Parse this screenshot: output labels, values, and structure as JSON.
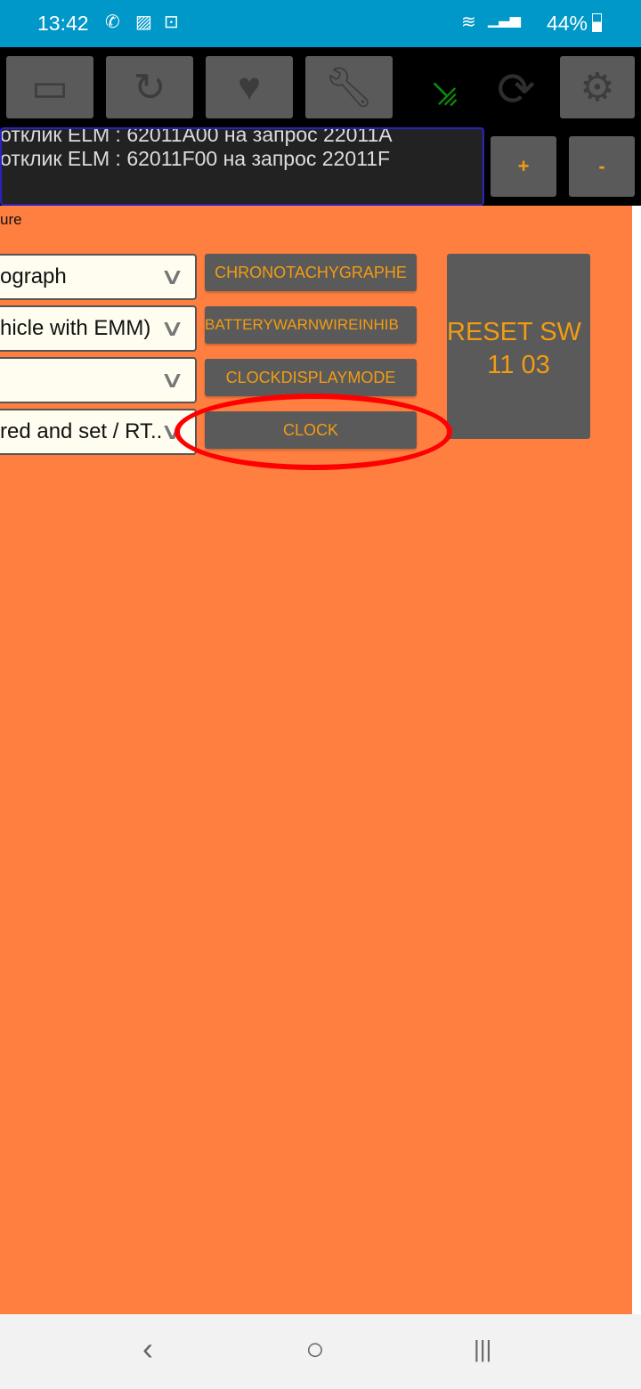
{
  "status_bar": {
    "time": "13:42",
    "battery": "44%",
    "icons": [
      "phone-call-icon",
      "image-icon",
      "car-lock-icon",
      "wifi-icon",
      "signal-icon",
      "signal-icon",
      "battery-icon"
    ]
  },
  "toolbar": {
    "buttons": [
      "folder-icon",
      "refresh-icon",
      "heart-icon",
      "wrench-icon"
    ],
    "connection_color": "#0a8a0a",
    "sync_icon": "sync-icon",
    "settings_icon": "gear-icon"
  },
  "log": {
    "lines": [
      "отклик ELM : 62011A00 на запрос 22011A",
      "отклик ELM : 62011F00 на запрос 22011F"
    ]
  },
  "zoom": {
    "plus": "+",
    "minus": "-"
  },
  "main": {
    "label": "ure",
    "selects": [
      "ograph",
      "hicle with EMM)",
      "",
      "red and set / RT.."
    ],
    "buttons": [
      "CHRONOTACHYGRAPHE",
      "BATTERYWARNWIREINHIB",
      "CLOCKDISPLAYMODE",
      "CLOCK"
    ],
    "reset_line1": "RESET SW :",
    "reset_line2": "11 03",
    "highlight_color": "#ff0000",
    "background_color": "#ff7f40"
  },
  "nav": {
    "back": "‹",
    "home": "○",
    "recents": "|||"
  }
}
